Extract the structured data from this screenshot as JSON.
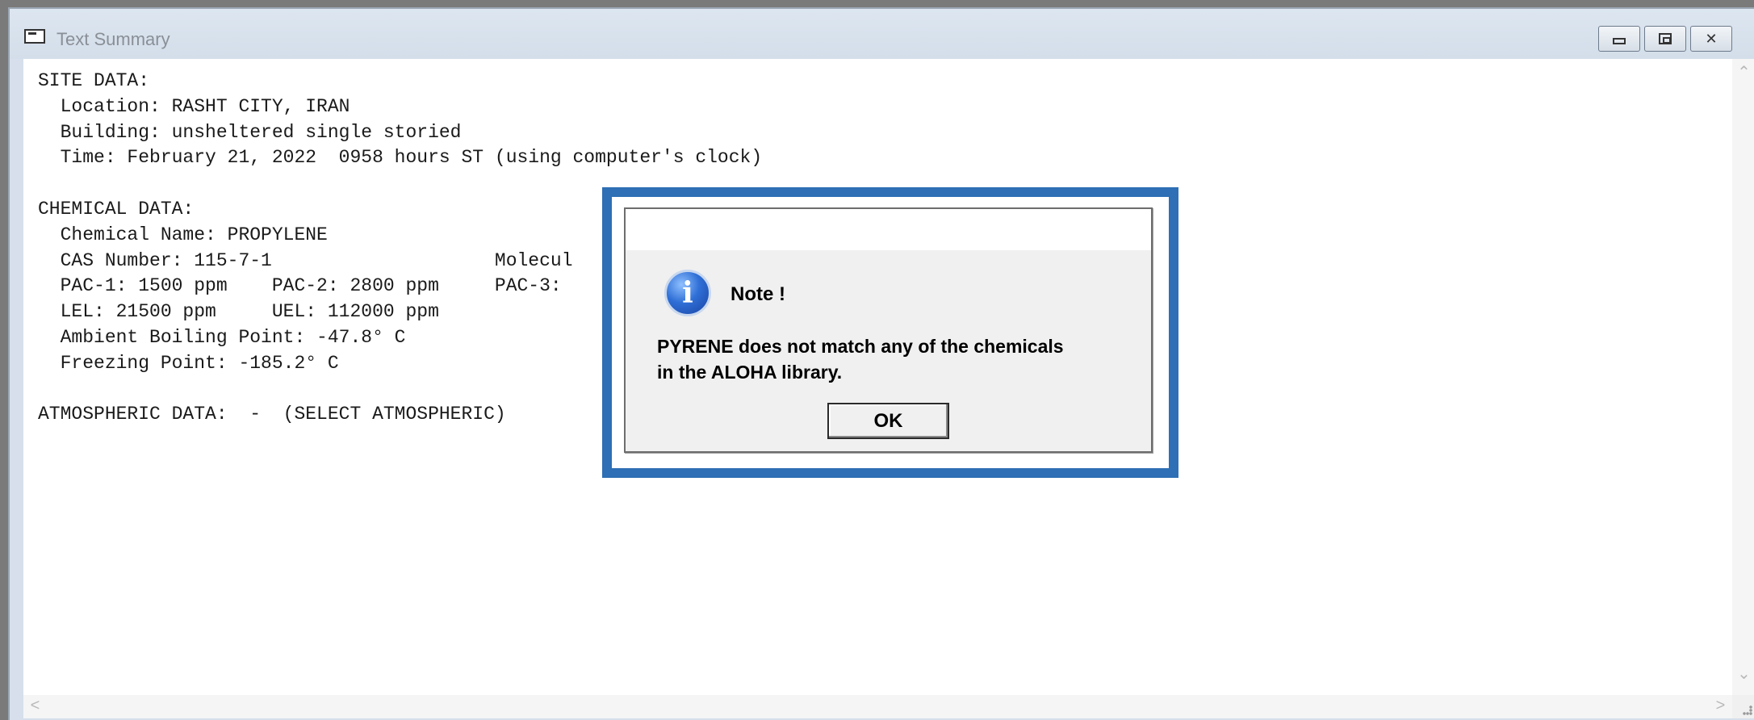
{
  "window": {
    "title": "Text Summary"
  },
  "summary": {
    "lines": [
      "SITE DATA:",
      "  Location: RASHT CITY, IRAN",
      "  Building: unsheltered single storied",
      "  Time: February 21, 2022  0958 hours ST (using computer's clock)",
      "",
      "CHEMICAL DATA:",
      "  Chemical Name: PROPYLENE",
      "  CAS Number: 115-7-1                    Molecul",
      "  PAC-1: 1500 ppm    PAC-2: 2800 ppm     PAC-3:",
      "  LEL: 21500 ppm     UEL: 112000 ppm",
      "  Ambient Boiling Point: -47.8° C",
      "  Freezing Point: -185.2° C",
      "",
      "ATMOSPHERIC DATA:  -  (SELECT ATMOSPHERIC)"
    ]
  },
  "dialog": {
    "title": "Note !",
    "message_line1": "PYRENE does not match any of the chemicals",
    "message_line2": "in the ALOHA library.",
    "ok_label": "OK",
    "icon": "info-icon"
  },
  "scroll": {
    "up_glyph": "⌃",
    "down_glyph": "⌄",
    "left_glyph": "<",
    "right_glyph": ">"
  },
  "colors": {
    "highlight": "#2e6fb5"
  }
}
